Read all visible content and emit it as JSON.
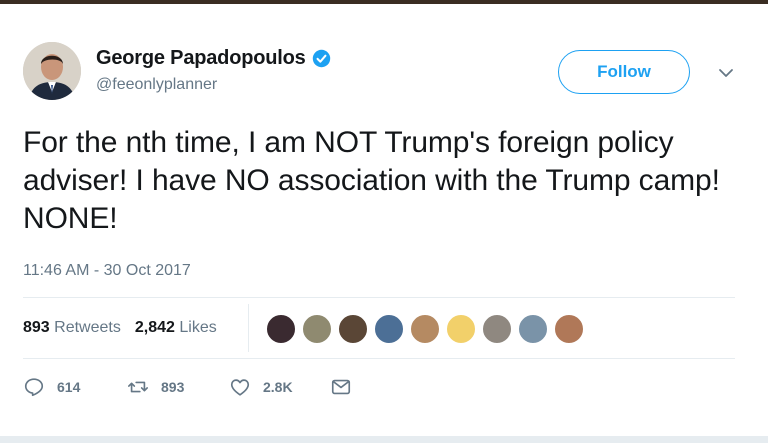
{
  "user": {
    "name": "George Papadopoulos",
    "handle": "@feeonlyplanner",
    "verified": true
  },
  "follow_label": "Follow",
  "tweet": {
    "text": "For the nth time, I am NOT Trump's foreign policy adviser! I have NO association with the Trump camp! NONE!",
    "timestamp": "11:46 AM - 30 Oct 2017"
  },
  "stats": {
    "retweets_count": "893",
    "retweets_label": "Retweets",
    "likes_count": "2,842",
    "likes_label": "Likes"
  },
  "likers": [
    {
      "color": "#3a2a30"
    },
    {
      "color": "#8f8a70"
    },
    {
      "color": "#5a4636"
    },
    {
      "color": "#4c6f96"
    },
    {
      "color": "#b58a62"
    },
    {
      "color": "#f2d06a"
    },
    {
      "color": "#8f8880"
    },
    {
      "color": "#7a93a8"
    },
    {
      "color": "#b07858"
    }
  ],
  "actions": {
    "replies": "614",
    "retweets": "893",
    "likes": "2.8K"
  },
  "colors": {
    "accent": "#1da1f2",
    "text": "#14171a",
    "secondary": "#657786",
    "divider": "#e6ecf0"
  },
  "icons": [
    "verified-badge-icon",
    "chevron-down-icon",
    "reply-icon",
    "retweet-icon",
    "heart-icon",
    "message-icon"
  ]
}
